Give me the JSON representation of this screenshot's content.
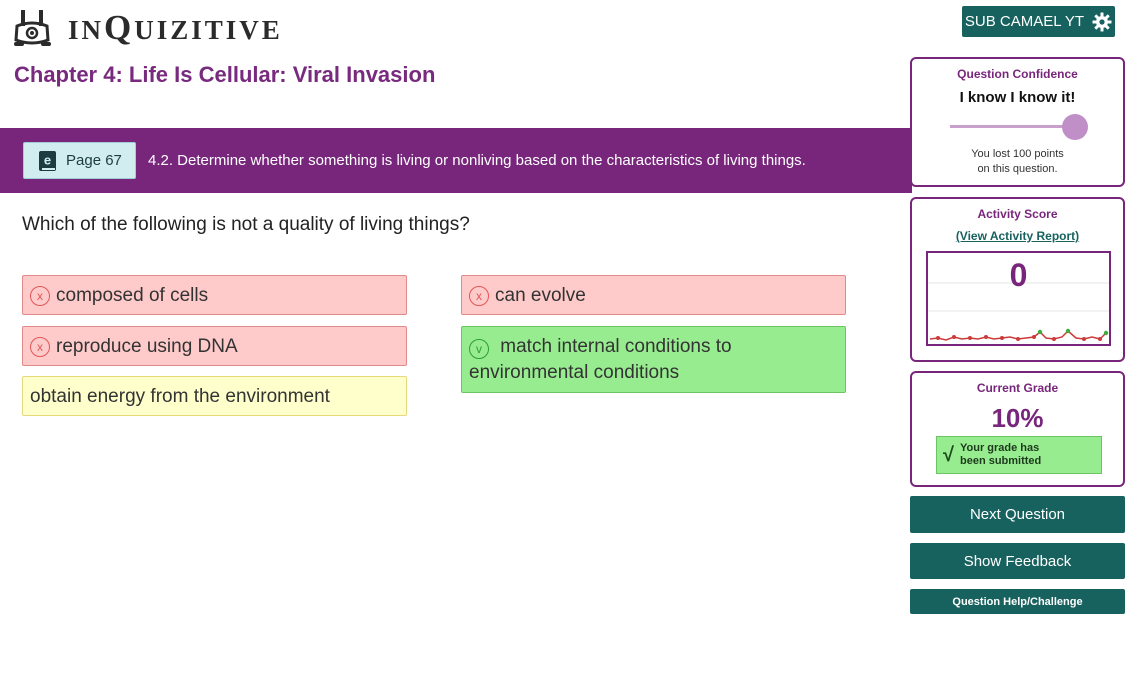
{
  "header": {
    "logo_prefix": "IN",
    "logo_main": "Q",
    "logo_rest": "UIZITIVE",
    "user_button_label": "SUB CAMAEL YT",
    "chapter_title": "Chapter 4: Life Is Cellular: Viral Invasion"
  },
  "objective_bar": {
    "page_label": "Page 67",
    "objective_text": "4.2. Determine whether something is living or nonliving based on the characteristics of living things."
  },
  "question": {
    "text": "Which of the following is not a quality of living things?",
    "answers": [
      {
        "label": "composed of cells",
        "status": "wrong",
        "mark": "x"
      },
      {
        "label": "can evolve",
        "status": "wrong",
        "mark": "x"
      },
      {
        "label": "reproduce using DNA",
        "status": "wrong",
        "mark": "x"
      },
      {
        "label": "match internal conditions to environmental conditions",
        "status": "correct",
        "mark": "v"
      },
      {
        "label": "obtain energy from the environment",
        "status": "neutral",
        "mark": ""
      }
    ]
  },
  "confidence": {
    "title": "Question Confidence",
    "value_label": "I know I know it!",
    "level": 1.0,
    "note_line1": "You lost 100 points",
    "note_line2": "on this question."
  },
  "activity": {
    "title": "Activity Score",
    "report_link": "(View Activity Report)",
    "score": "0"
  },
  "grade": {
    "title": "Current Grade",
    "value": "10%",
    "submitted_line1": "Your grade has",
    "submitted_line2": "been submitted"
  },
  "actions": {
    "next_label": "Next Question",
    "feedback_label": "Show Feedback",
    "help_label": "Question Help/Challenge"
  },
  "colors": {
    "brand_purple": "#78267c",
    "teal": "#17625f",
    "wrong_bg": "#fecaca",
    "correct_bg": "#98ec90",
    "neutral_bg": "#ffffcc"
  }
}
